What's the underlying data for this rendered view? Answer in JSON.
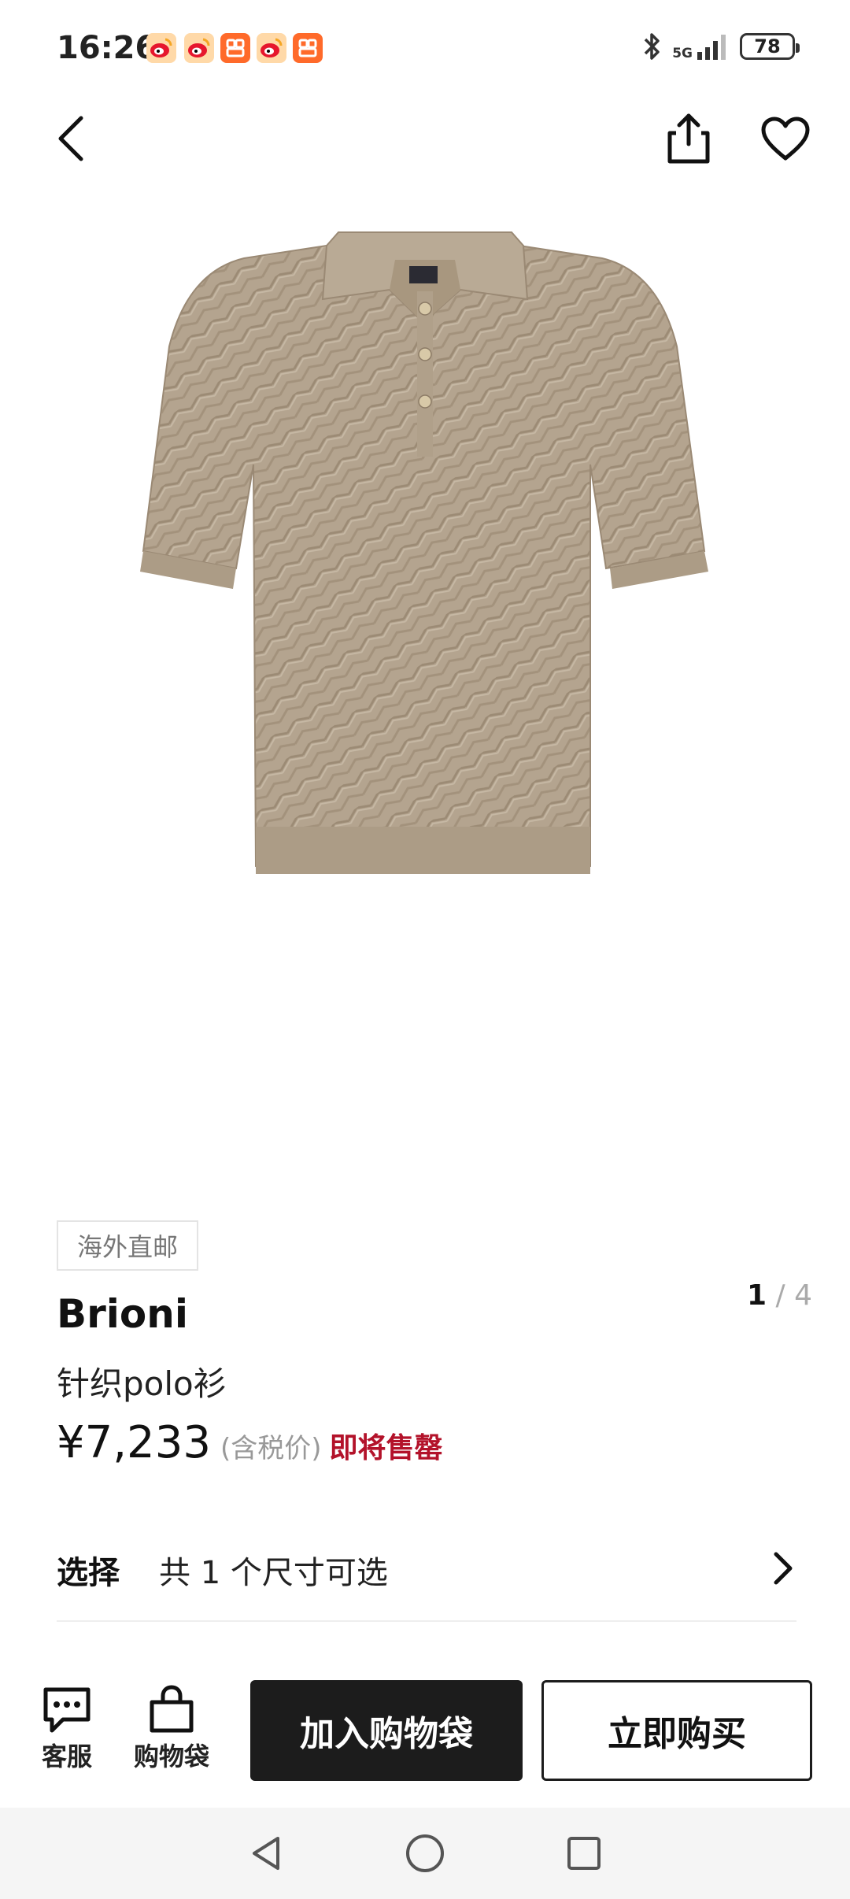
{
  "status_bar": {
    "time": "16:26",
    "network": "5G",
    "battery": "78",
    "notifications": [
      "weibo-icon",
      "weibo-icon",
      "app-icon",
      "weibo-icon",
      "app-icon"
    ]
  },
  "gallery": {
    "current": "1",
    "separator": "/ ",
    "total": "4"
  },
  "product": {
    "tag": "海外直邮",
    "brand": "Brioni",
    "title": "针织polo衫",
    "price": "¥7,233",
    "tax_note": "(含税价)",
    "stock_status": "即将售罄"
  },
  "size_select": {
    "label": "选择",
    "value": "共 1 个尺寸可选"
  },
  "bottom_bar": {
    "service_label": "客服",
    "bag_label": "购物袋",
    "add_to_bag": "加入购物袋",
    "buy_now": "立即购买"
  },
  "colors": {
    "sold_out": "#b3122a",
    "primary_button": "#1c1c1c",
    "shirt": "#b4a48f"
  }
}
